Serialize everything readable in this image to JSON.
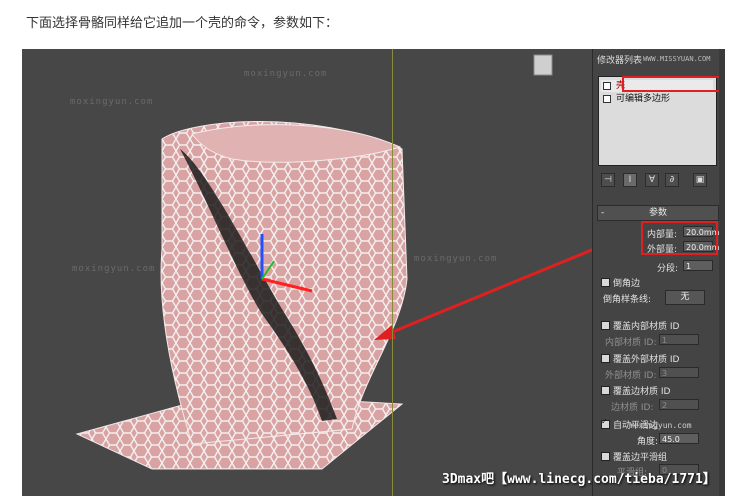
{
  "caption": "下面选择骨骼同样给它追加一个壳的命令，参数如下：",
  "watermarks": {
    "viewport_top": "moxingyun.com",
    "viewport_left_mid": "moxingyun.com",
    "viewport_center": "moxingyun.com",
    "viewport_left_bottom": "moxingyun.com",
    "panel_top": "WWW.MISSYUAN.COM",
    "panel_bottom": "moxingyun.com"
  },
  "footer_brand": "3Dmax吧【www.linecg.com/tieba/1771】",
  "panel": {
    "top_label": "修改器列表",
    "stack": [
      "壳",
      "可编辑多边形"
    ],
    "tools": [
      "⊣",
      "I",
      "∀",
      "∂",
      "▣"
    ],
    "rollout_title": "参数",
    "inner_amount_label": "内部量:",
    "inner_amount_value": "20.0mm",
    "outer_amount_label": "外部量:",
    "outer_amount_value": "20.0mm",
    "segments_label": "分段:",
    "segments_value": "1",
    "bevel_edges_label": "倒角边",
    "bevel_spline_label": "倒角样条线:",
    "bevel_spline_button": "无",
    "override_inner_mat_label": "覆盖内部材质 ID",
    "inner_mat_id_label": "内部材质 ID:",
    "inner_mat_id_value": "1",
    "override_outer_mat_label": "覆盖外部材质 ID",
    "outer_mat_id_label": "外部材质 ID:",
    "outer_mat_id_value": "3",
    "override_edge_mat_label": "覆盖边材质 ID",
    "edge_mat_id_label": "边材质 ID:",
    "edge_mat_id_value": "2",
    "auto_smooth_label": "自动平滑边",
    "angle_label": "角度:",
    "angle_value": "45.0",
    "override_edge_smooth_label": "覆盖边平滑组",
    "smooth_group_label": "平滑组:",
    "smooth_group_value": "0"
  },
  "colors": {
    "viewport_bg": "#474747",
    "mesh_pink": "#d9a3a3",
    "annotation_red": "#e02020"
  }
}
